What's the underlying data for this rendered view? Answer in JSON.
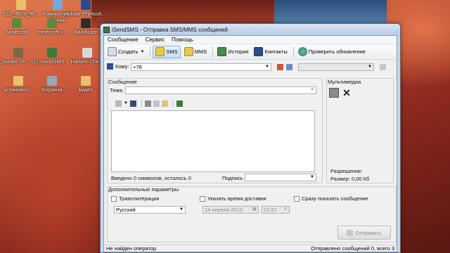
{
  "desktop": {
    "icons": [
      {
        "label": "512_4576_Bl...",
        "color": "#e8c26a"
      },
      {
        "label": "Компьютер - Ярлык",
        "color": "#7aa6d8"
      },
      {
        "label": "Adobe Photosh...",
        "color": "#2f4a8a"
      },
      {
        "label": "Minecraft",
        "color": "#5f8a3a"
      },
      {
        "label": "minecraft-v...",
        "color": "#5f8a3a"
      },
      {
        "label": "Bandicam",
        "color": "#2d2d2d"
      },
      {
        "label": "Counter-Str... (2)",
        "color": "#7a6a4a"
      },
      {
        "label": "iSendSMS",
        "color": "#3a7a3a"
      },
      {
        "label": "Harlem-Che...",
        "color": "#d8d8d8"
      },
      {
        "label": "установоч...",
        "color": "#e8c26a"
      },
      {
        "label": "Корзина",
        "color": "#9aa8b8"
      },
      {
        "label": "видео",
        "color": "#e8c26a"
      }
    ]
  },
  "window": {
    "title": "iSendSMS - Отправка SMS/MMS сообщений",
    "menu": [
      "Сообщение",
      "Сервис",
      "Помощь"
    ],
    "toolbar": {
      "create": "Создать",
      "sms": "SMS",
      "mms": "MMS",
      "history": "История",
      "contacts": "Контакты",
      "check_update": "Проверить обновление"
    },
    "to_label": "Кому:",
    "to_value": "+78",
    "message_group": "Сообщение",
    "subject_label": "Тема:",
    "counter_text": "Введено 0 символов, осталось 0",
    "signature_label": "Подпись",
    "multimedia": {
      "title": "Мультимедиа",
      "resolution_label": "Разрешение:",
      "size_label": "Размер: 0,00 Кб"
    },
    "extra": {
      "title": "Дополнительные параметры",
      "translit": "Транслитерация",
      "delivery_time": "Указать время доставки",
      "show_immediately": "Сразу показать сообщение",
      "language": "Русский",
      "date": "14  апреля  2013",
      "time": "21:57"
    },
    "send_button": "Отправить",
    "status_left": "Не найден оператор",
    "status_right": "Отправлено сообщений 0, всего 3"
  },
  "colors": {
    "accent": "#3a7a3a",
    "window_frame": "#c3d6ea"
  }
}
